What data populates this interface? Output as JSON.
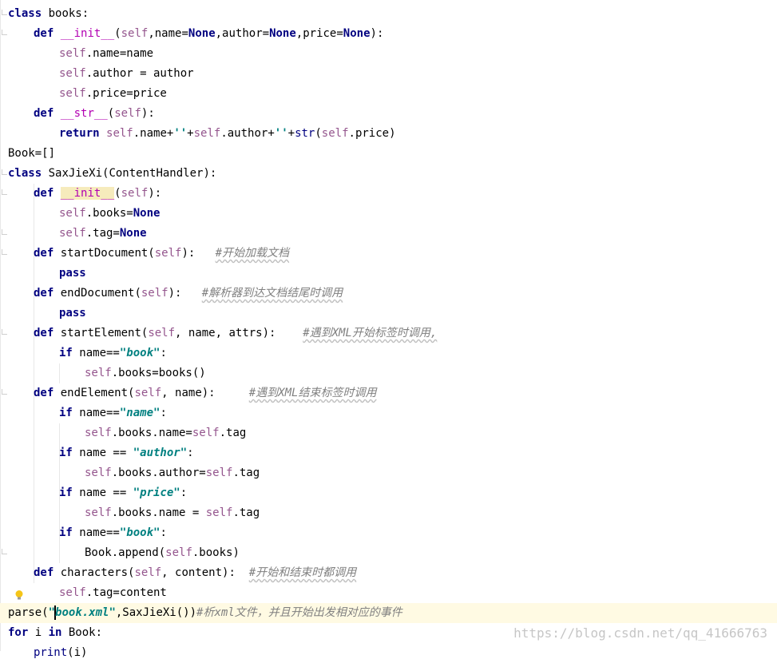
{
  "editor": {
    "lines": [
      "class books:",
      "def __init__(self,name=None,author=None,price=None):",
      "self.name=name",
      "self.author = author",
      "self.price=price",
      "def __str__(self):",
      "return self.name+''+self.author+''+str(self.price)",
      "Book=[]",
      "class SaxJieXi(ContentHandler):",
      "def __init__(self):",
      "self.books=None",
      "self.tag=None",
      "def startDocument(self):   #开始加载文档",
      "pass",
      "def endDocument(self):   #解析器到达文档结尾时调用",
      "pass",
      "def startElement(self, name, attrs):    #遇到XML开始标签时调用,",
      "if name==\"book\":",
      "self.books=books()",
      "def endElement(self, name):     #遇到XML结束标签时调用",
      "if name==\"name\":",
      "self.books.name=self.tag",
      "if name == \"author\":",
      "self.books.author=self.tag",
      "if name == \"price\":",
      "self.books.name = self.tag",
      "if name==\"book\":",
      "Book.append(self.books)",
      "def characters(self, content):  #开始和结束时都调用",
      "self.tag=content",
      "parse(\"book.xml\",SaxJieXi())#析xml文件，并且开始出发相对应的事件",
      "for i in Book:",
      "print(i)"
    ],
    "watermark": "https://blog.csdn.net/qq_41666763"
  },
  "colors": {
    "keyword": "#000080",
    "self": "#94558d",
    "magic": "#b200b2",
    "string": "#008080",
    "comment": "#808080",
    "caret_row": "#fffae3"
  },
  "icons": {
    "lightbulb": "lightbulb-icon"
  }
}
